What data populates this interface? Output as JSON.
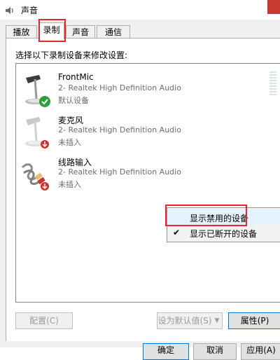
{
  "window": {
    "title": "声音"
  },
  "tabs": [
    {
      "label": "播放"
    },
    {
      "label": "录制"
    },
    {
      "label": "声音"
    },
    {
      "label": "通信"
    }
  ],
  "instruction": "选择以下录制设备来修改设置:",
  "devices": [
    {
      "name": "FrontMic",
      "description": "2- Realtek High Definition Audio",
      "status": "默认设备",
      "status_badge": "green-check-icon"
    },
    {
      "name": "麦克风",
      "description": "2- Realtek High Definition Audio",
      "status": "未插入",
      "status_badge": "red-down-arrow-icon"
    },
    {
      "name": "线路输入",
      "description": "2- Realtek High Definition Audio",
      "status": "未插入",
      "status_badge": "red-down-arrow-icon"
    }
  ],
  "context_menu": {
    "items": [
      {
        "label": "显示禁用的设备",
        "checked": false
      },
      {
        "label": "显示已断开的设备",
        "checked": true
      }
    ]
  },
  "buttons": {
    "configure": "配置(C)",
    "set_default": "设为默认值(S)",
    "properties": "属性(P)",
    "ok": "确定",
    "cancel": "取消",
    "apply": "应用(A)"
  },
  "colors": {
    "highlight_box": "#e8262e",
    "check_green": "#2e9e3a",
    "badge_red": "#d32f2f"
  }
}
